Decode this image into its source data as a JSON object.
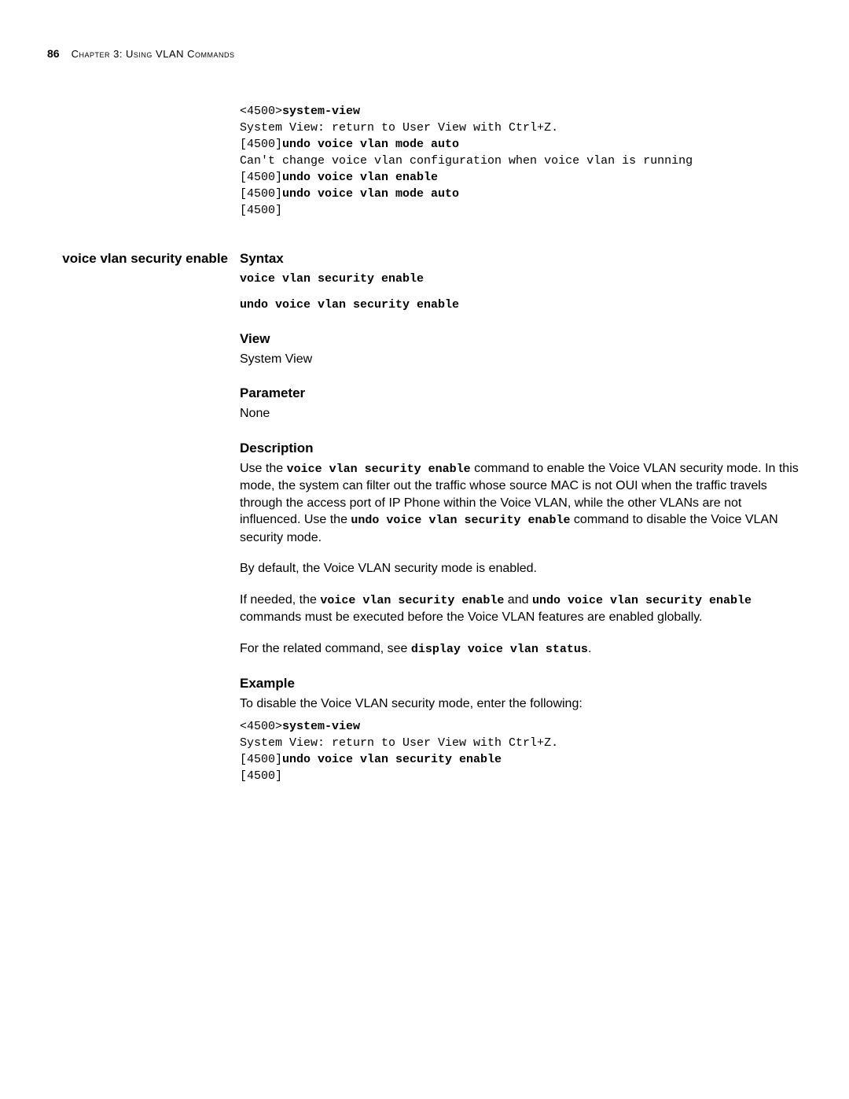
{
  "header": {
    "page_number": "86",
    "chapter_label": "Chapter 3: Using VLAN Commands"
  },
  "top_code": {
    "l1a": "<4500>",
    "l1b": "system-view",
    "l2": "System View: return to User View with Ctrl+Z.",
    "l3a": "[4500]",
    "l3b": "undo voice vlan mode auto",
    "l4": "Can't change voice vlan configuration when voice vlan is running",
    "l5a": "[4500]",
    "l5b": "undo voice vlan enable",
    "l6a": "[4500]",
    "l6b": "undo voice vlan mode auto",
    "l7": "[4500]"
  },
  "side_heading": "voice vlan security enable",
  "syntax": {
    "title": "Syntax",
    "line1": "voice vlan security enable",
    "line2": "undo voice vlan security enable"
  },
  "view": {
    "title": "View",
    "text": "System View"
  },
  "parameter": {
    "title": "Parameter",
    "text": "None"
  },
  "description": {
    "title": "Description",
    "p1_a": "Use the ",
    "p1_cmd1": "voice vlan security enable",
    "p1_b": " command to enable the Voice VLAN security mode. In this mode, the system can filter out the traffic whose source MAC is not OUI when the traffic travels through the access port of IP Phone within the Voice VLAN, while the other VLANs are not influenced. Use the ",
    "p1_cmd2": "undo voice vlan security enable",
    "p1_c": " command to disable the Voice VLAN security mode.",
    "p2": "By default, the Voice VLAN security mode is enabled.",
    "p3_a": "If needed, the ",
    "p3_cmd1": "voice vlan security enable",
    "p3_b": " and ",
    "p3_cmd2": "undo voice vlan security enable",
    "p3_c": " commands must be executed before the Voice VLAN features are enabled globally.",
    "p4_a": "For the related command, see ",
    "p4_cmd": "display voice vlan status",
    "p4_b": "."
  },
  "example": {
    "title": "Example",
    "intro": "To disable the Voice VLAN security mode, enter the following:",
    "l1a": "<4500>",
    "l1b": "system-view",
    "l2": "System View: return to User View with Ctrl+Z.",
    "l3a": "[4500]",
    "l3b": "undo voice vlan security enable",
    "l4": "[4500]"
  }
}
